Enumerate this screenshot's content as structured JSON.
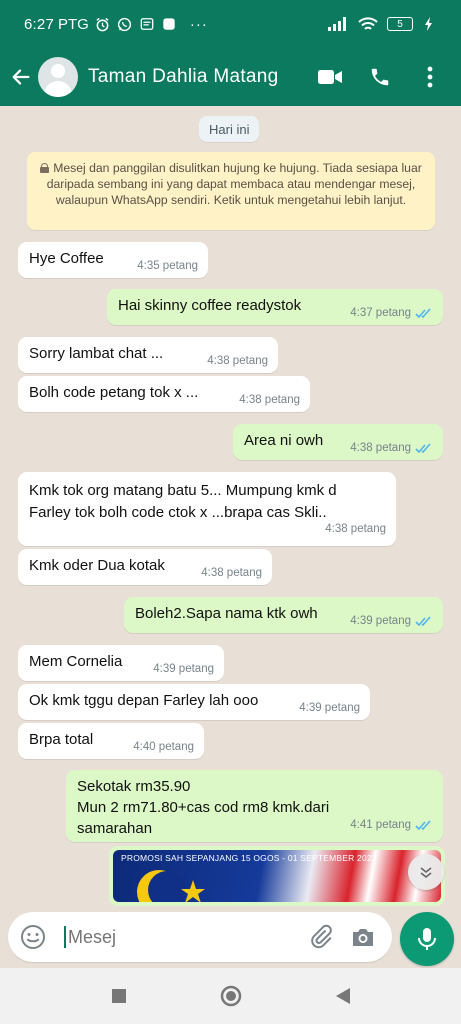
{
  "status_bar": {
    "time": "6:27",
    "carrier": "PTG",
    "battery": "5"
  },
  "header": {
    "contact_name": "Taman Dahlia Matang"
  },
  "chat": {
    "date_chip": "Hari ini",
    "encryption_notice": "Mesej dan panggilan disulitkan hujung ke hujung. Tiada sesiapa luar daripada sembang ini yang dapat membaca atau mendengar mesej, walaupun WhatsApp sendiri. Ketik untuk mengetahui lebih lanjut.",
    "messages": [
      {
        "dir": "in",
        "text": "Hye Coffee",
        "time": "4:35 petang"
      },
      {
        "dir": "out",
        "text": "Hai  skinny coffee readystok",
        "time": "4:37 petang"
      },
      {
        "dir": "in",
        "text": "Sorry lambat chat ...",
        "time": "4:38 petang"
      },
      {
        "dir": "in",
        "text": "Bolh code petang tok x ...",
        "time": "4:38 petang"
      },
      {
        "dir": "out",
        "text": "Area ni owh",
        "time": "4:38 petang"
      },
      {
        "dir": "in",
        "text": "Kmk tok org matang batu 5... Mumpung kmk d Farley tok bolh code ctok x ...brapa cas Skli..",
        "time": "4:38 petang"
      },
      {
        "dir": "in",
        "text": "Kmk oder Dua kotak",
        "time": "4:38 petang"
      },
      {
        "dir": "out",
        "text": "Boleh2.Sapa nama ktk owh",
        "time": "4:39 petang"
      },
      {
        "dir": "in",
        "text": "Mem Cornelia",
        "time": "4:39 petang"
      },
      {
        "dir": "in",
        "text": "Ok kmk tggu depan Farley lah ooo",
        "time": "4:39 petang"
      },
      {
        "dir": "in",
        "text": "Brpa total",
        "time": "4:40 petang"
      },
      {
        "dir": "out",
        "text": "Sekotak rm35.90\nMun 2 rm71.80+cas cod rm8 kmk.dari samarahan",
        "time": "4:41 petang"
      }
    ],
    "image_caption": "PROMOSI SAH SEPANJANG 15 OGOS - 01 SEPTEMBER 2022"
  },
  "composer": {
    "placeholder": "Mesej"
  },
  "colors": {
    "header": "#0b7a5f",
    "outgoing": "#dcf8c6",
    "incoming": "#ffffff",
    "read_tick": "#4fb6ec",
    "mic": "#0b9a73"
  }
}
